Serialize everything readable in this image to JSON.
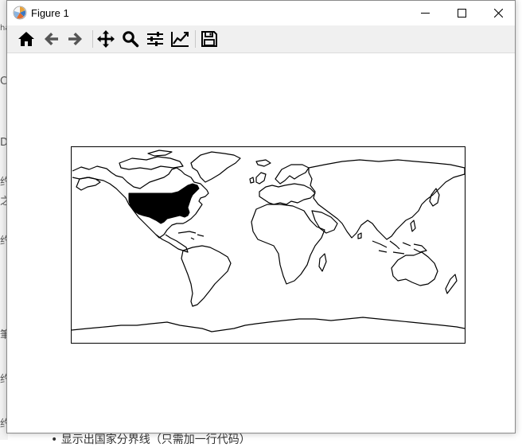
{
  "window": {
    "title": "Figure 1",
    "app_icon": "matplotlib-icon",
    "controls": [
      "minimize-icon",
      "maximize-icon",
      "close-icon"
    ]
  },
  "toolbar": {
    "buttons": [
      {
        "name": "home-button",
        "icon": "home-icon"
      },
      {
        "name": "back-button",
        "icon": "arrow-left-icon"
      },
      {
        "name": "forward-button",
        "icon": "arrow-right-icon"
      },
      {
        "name": "pan-button",
        "icon": "move-icon"
      },
      {
        "name": "zoom-button",
        "icon": "magnifier-icon"
      },
      {
        "name": "configure-subplots-button",
        "icon": "sliders-icon"
      },
      {
        "name": "edit-axes-button",
        "icon": "line-chart-icon"
      },
      {
        "name": "save-button",
        "icon": "floppy-disk-icon"
      }
    ]
  },
  "figure": {
    "content": "world-map-with-filled-usa",
    "highlighted_region": "United States",
    "fill_color": "#000000",
    "coastline_color": "#000000"
  },
  "background": {
    "left_glyphs": [
      "ha",
      "C",
      "D",
      "约",
      "之",
      "约",
      "筆",
      "约",
      "约"
    ],
    "bottom_text": "• 显示出国家分界线（只需加一行代码）"
  }
}
